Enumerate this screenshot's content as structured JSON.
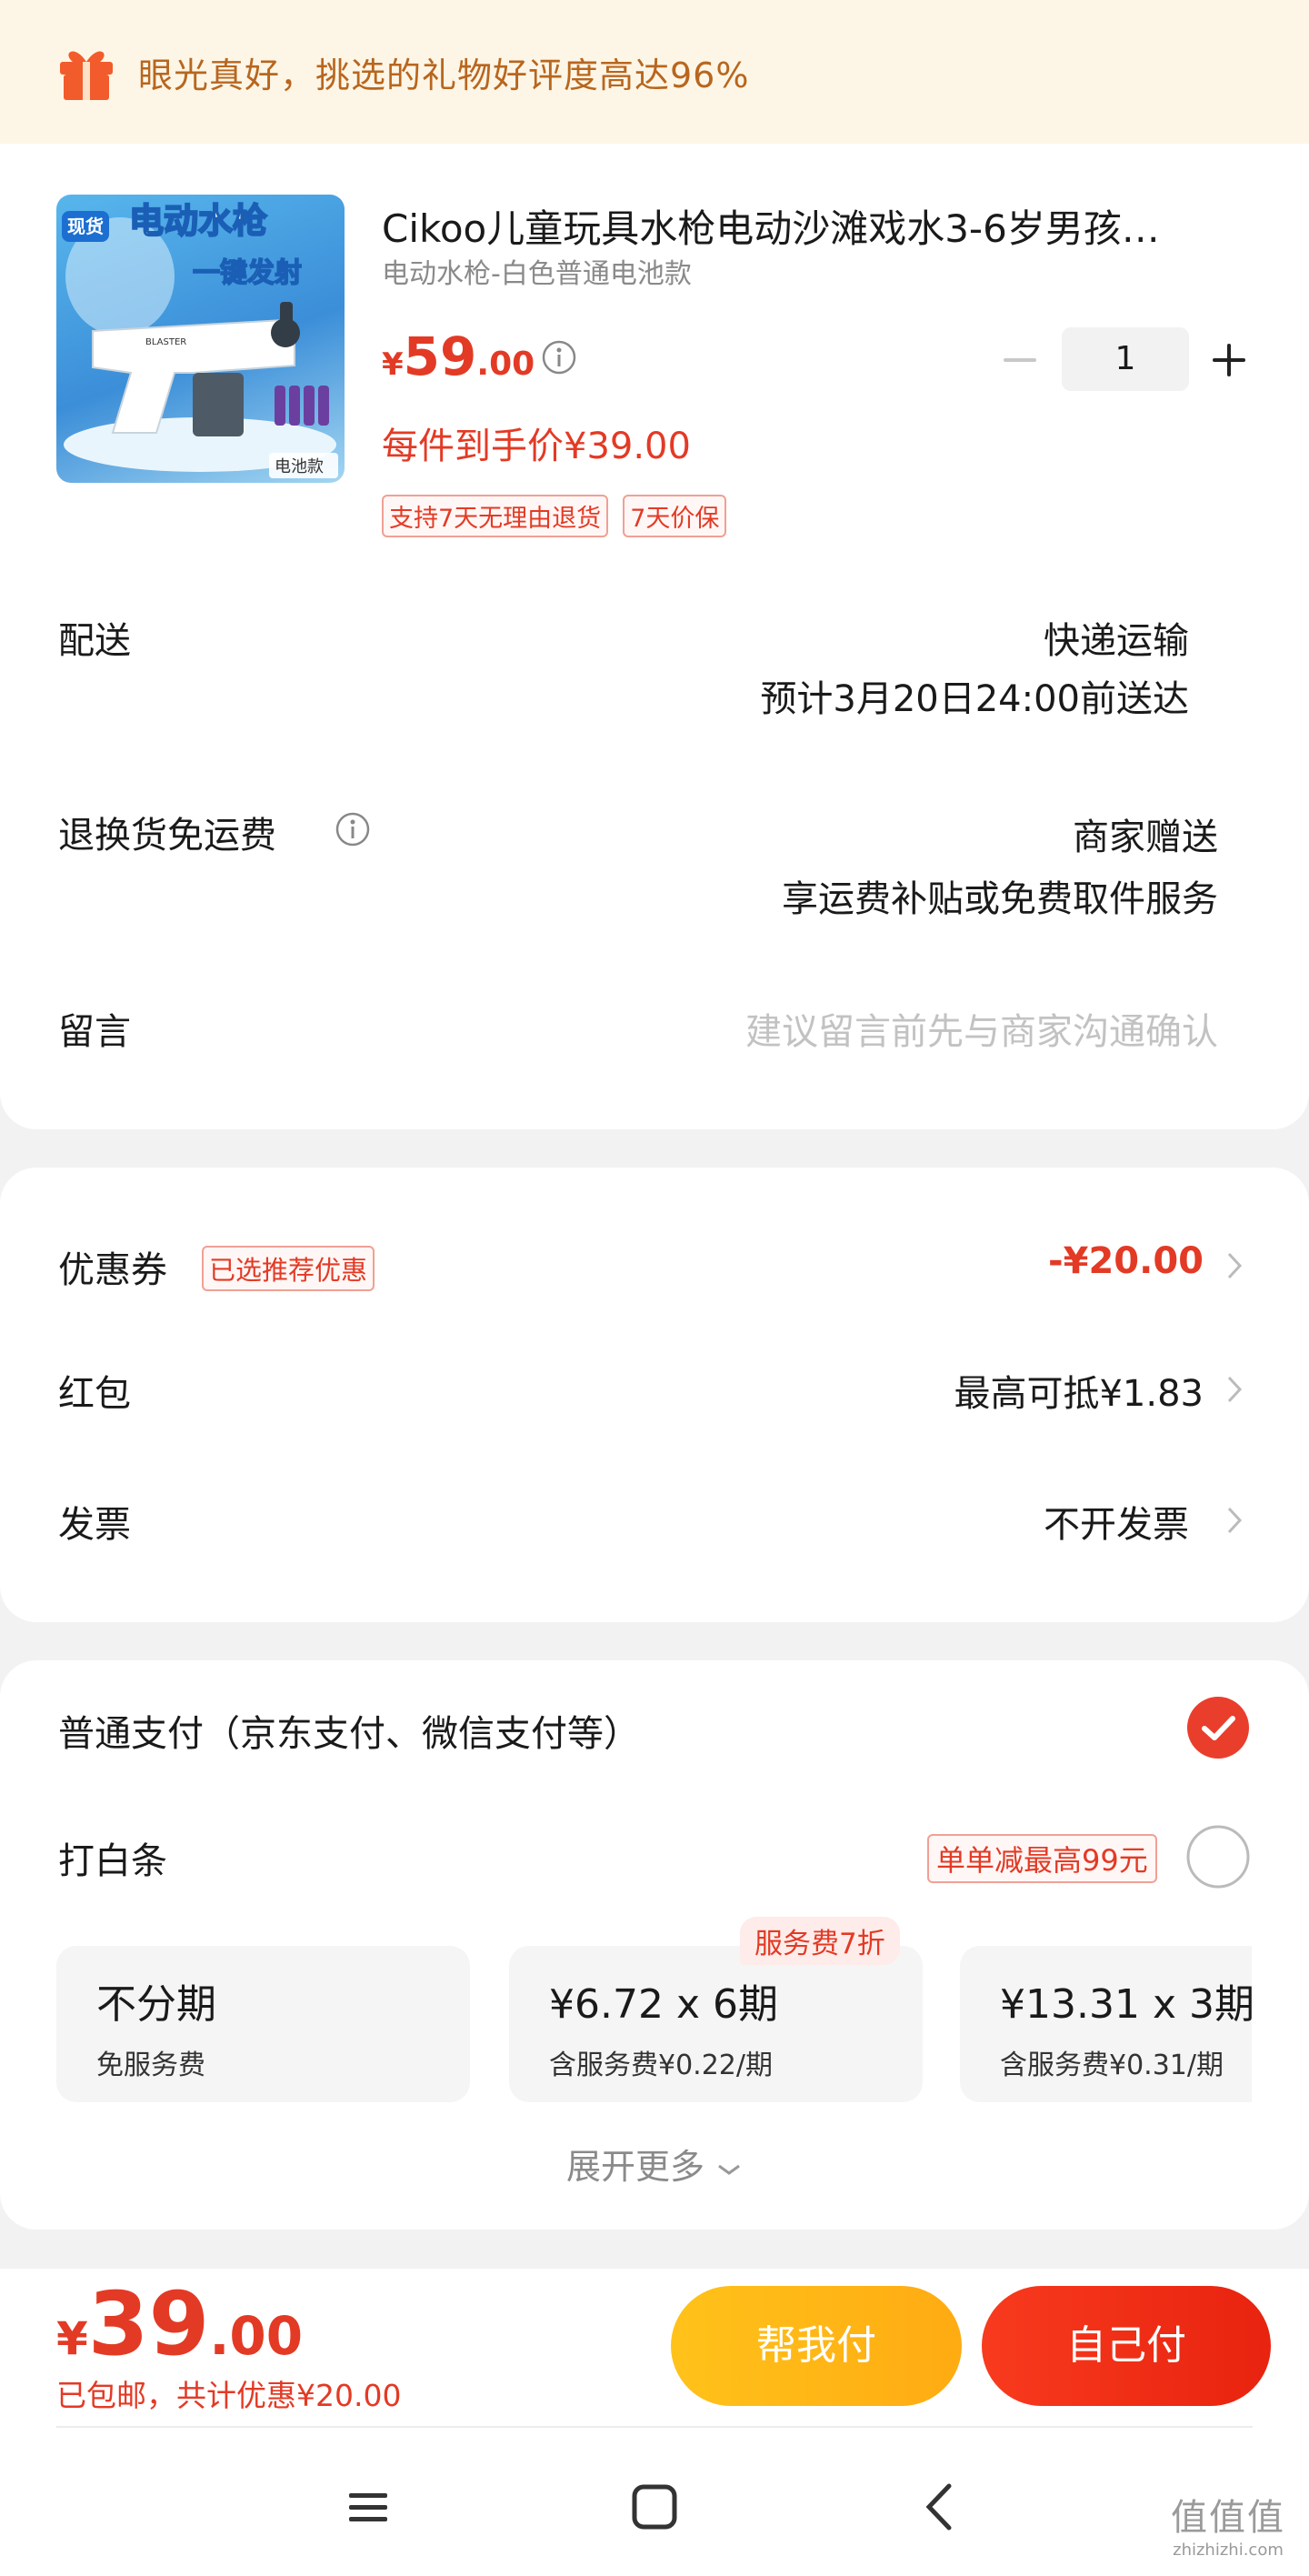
{
  "banner": {
    "text": "眼光真好，挑选的礼物好评度高达96%"
  },
  "product": {
    "image_text_top": "电动水枪",
    "image_text_mid": "一键发射",
    "image_badge": "现货",
    "image_corner": "电池款",
    "image_gun_label": "BLASTER",
    "title": "Cikoo儿童玩具水枪电动沙滩戏水3-6岁男孩…",
    "variant": "电动水枪-白色普通电池款",
    "price_currency": "¥",
    "price_int": "59",
    "price_dec": ".00",
    "quantity": "1",
    "hand_price": "每件到手价¥39.00",
    "tags": [
      "支持7天无理由退货",
      "7天价保"
    ]
  },
  "delivery": {
    "label": "配送",
    "method": "快递运输",
    "eta": "预计3月20日24:00前送达"
  },
  "return_shipping": {
    "label": "退换货免运费",
    "value": "商家赠送",
    "desc": "享运费补贴或免费取件服务"
  },
  "message": {
    "label": "留言",
    "placeholder": "建议留言前先与商家沟通确认"
  },
  "coupon": {
    "label": "优惠券",
    "badge": "已选推荐优惠",
    "value": "-¥20.00"
  },
  "red_packet": {
    "label": "红包",
    "value": "最高可抵¥1.83"
  },
  "invoice": {
    "label": "发票",
    "value": "不开发票"
  },
  "payment": {
    "normal_label": "普通支付（京东支付、微信支付等）",
    "normal_selected": true,
    "baitiao_label": "打白条",
    "baitiao_badge": "单单减最高99元",
    "baitiao_selected": false,
    "plans": [
      {
        "main": "不分期",
        "sub": "免服务费"
      },
      {
        "main": "¥6.72 x 6期",
        "sub": "含服务费¥0.22/期",
        "tag": "服务费7折"
      },
      {
        "main": "¥13.31 x 3期",
        "sub": "含服务费¥0.31/期"
      }
    ],
    "expand": "展开更多"
  },
  "summary": {
    "currency": "¥",
    "int": "39",
    "dec": ".00",
    "sub": "已包邮，共计优惠¥20.00",
    "help_pay": "帮我付",
    "self_pay": "自己付"
  },
  "watermark": {
    "main": "值值值",
    "sub": "zhizhizhi.com"
  },
  "colors": {
    "accent": "#e33a25",
    "banner_text": "#b8661e",
    "help_button": "#ffb615",
    "self_button": "#f0301a"
  }
}
